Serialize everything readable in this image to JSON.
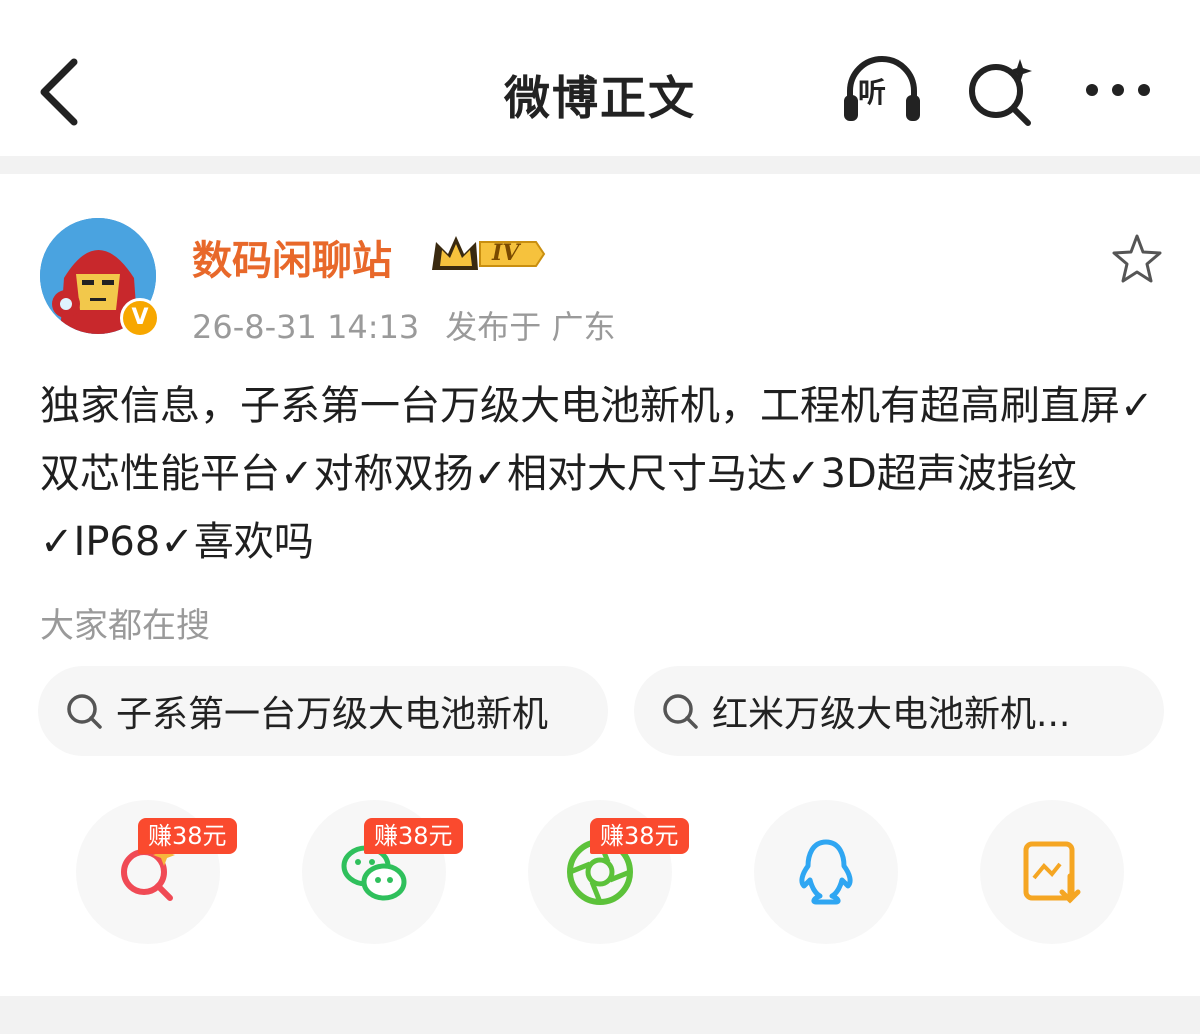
{
  "header": {
    "title": "微博正文",
    "listen_label": "听",
    "icons": [
      "back-arrow-icon",
      "headphones-listen-icon",
      "search-sparkle-icon",
      "more-dots-icon"
    ]
  },
  "post": {
    "author": "数码闲聊站",
    "level_badge": "IV",
    "verified_mark": "V",
    "date": "26-8-31 14:13",
    "location": "发布于 广东",
    "content": "独家信息，子系第一台万级大电池新机，工程机有超高刷直屏✓双芯性能平台✓对称双扬✓相对大尺寸马达✓3D超声波指纹✓IP68✓喜欢吗"
  },
  "searches": {
    "label": "大家都在搜",
    "items": [
      "子系第一台万级大电池新机",
      "红米万级大电池新机..."
    ]
  },
  "share": {
    "earn_label": "赚38元",
    "items": [
      {
        "icon": "ai-search-icon",
        "earn": "赚38元"
      },
      {
        "icon": "wechat-icon",
        "earn": "赚38元"
      },
      {
        "icon": "moments-shutter-icon",
        "earn": "赚38元"
      },
      {
        "icon": "qq-penguin-icon"
      },
      {
        "icon": "save-image-icon"
      }
    ]
  },
  "colors": {
    "username": "#e8682a",
    "earn_badge": "#fa4a2e",
    "wechat": "#2fc05c",
    "qq": "#2fa6f2",
    "save": "#f5a623",
    "ai_search": "#f04a55"
  }
}
